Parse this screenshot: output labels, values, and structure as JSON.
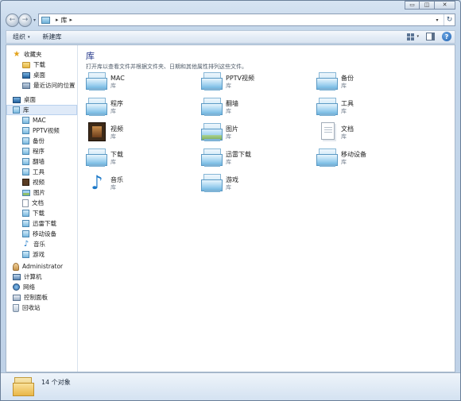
{
  "window": {
    "caption_buttons": {
      "minimize": "▭",
      "maximize": "◫",
      "close": "✕"
    }
  },
  "nav": {
    "back_glyph": "←",
    "forward_glyph": "→",
    "history_glyph": "▾",
    "address": {
      "separator": "▸",
      "segments": [
        "库"
      ],
      "trailing_separator": "▸",
      "dropdown_glyph": "▾",
      "refresh_glyph": "↻"
    }
  },
  "toolbar": {
    "organize_label": "组织",
    "new_library_label": "新建库",
    "caret": "▾",
    "help_glyph": "?"
  },
  "sidebar": {
    "favorites": {
      "label": "收藏夹",
      "items": [
        {
          "label": "下载",
          "icon": "folder-icon"
        },
        {
          "label": "桌面",
          "icon": "desktop-icon"
        },
        {
          "label": "最近访问的位置",
          "icon": "recent-places-icon"
        }
      ]
    },
    "desktop": {
      "label": "桌面"
    },
    "libraries": {
      "label": "库",
      "items": [
        {
          "label": "MAC",
          "icon": "library-icon"
        },
        {
          "label": "PPTV视频",
          "icon": "library-icon"
        },
        {
          "label": "备份",
          "icon": "library-icon"
        },
        {
          "label": "程序",
          "icon": "library-icon"
        },
        {
          "label": "翻墙",
          "icon": "library-icon"
        },
        {
          "label": "工具",
          "icon": "library-icon"
        },
        {
          "label": "视频",
          "icon": "video-library-icon"
        },
        {
          "label": "图片",
          "icon": "pictures-library-icon"
        },
        {
          "label": "文档",
          "icon": "documents-library-icon"
        },
        {
          "label": "下载",
          "icon": "library-icon"
        },
        {
          "label": "迅雷下载",
          "icon": "library-icon"
        },
        {
          "label": "移动设备",
          "icon": "library-icon"
        },
        {
          "label": "音乐",
          "icon": "music-library-icon"
        },
        {
          "label": "游戏",
          "icon": "library-icon"
        }
      ]
    },
    "others": [
      {
        "label": "Administrator",
        "icon": "user-icon"
      },
      {
        "label": "计算机",
        "icon": "computer-icon"
      },
      {
        "label": "网络",
        "icon": "network-icon"
      },
      {
        "label": "控制面板",
        "icon": "control-panel-icon"
      },
      {
        "label": "回收站",
        "icon": "recycle-bin-icon"
      }
    ]
  },
  "content": {
    "title": "库",
    "description": "打开库以查看文件并根据文件夹、日期和其他属性排列这些文件。",
    "type_label": "库",
    "libraries": [
      {
        "name": "MAC",
        "icon": "library-icon"
      },
      {
        "name": "PPTV视频",
        "icon": "library-icon"
      },
      {
        "name": "备份",
        "icon": "library-icon"
      },
      {
        "name": "程序",
        "icon": "library-icon"
      },
      {
        "name": "翻墙",
        "icon": "library-icon"
      },
      {
        "name": "工具",
        "icon": "library-icon"
      },
      {
        "name": "视频",
        "icon": "video-library-icon"
      },
      {
        "name": "图片",
        "icon": "pictures-library-icon"
      },
      {
        "name": "文档",
        "icon": "documents-library-icon"
      },
      {
        "name": "下载",
        "icon": "library-icon"
      },
      {
        "name": "迅雷下载",
        "icon": "library-icon"
      },
      {
        "name": "移动设备",
        "icon": "library-icon"
      },
      {
        "name": "音乐",
        "icon": "music-library-icon"
      },
      {
        "name": "游戏",
        "icon": "library-icon"
      }
    ]
  },
  "details": {
    "count_text": "14 个对象"
  },
  "colors": {
    "title_blue": "#1e3287",
    "selection": "#dfeaf8"
  }
}
